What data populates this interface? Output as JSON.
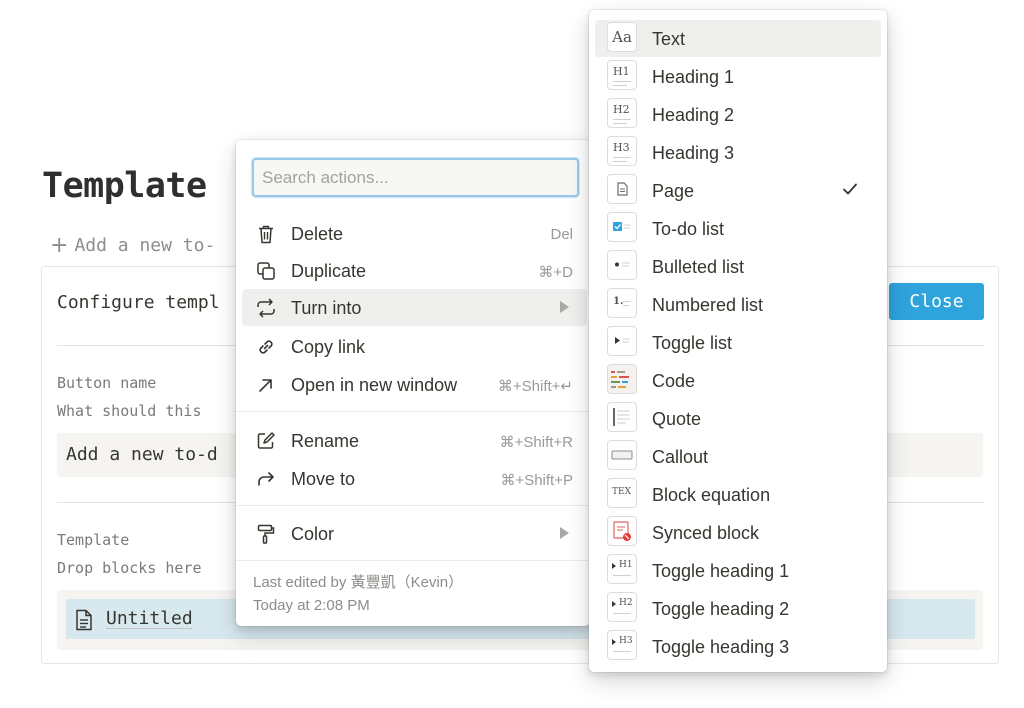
{
  "page": {
    "title": "Template",
    "add_todo": "Add a new to-"
  },
  "config": {
    "title": "Configure templ",
    "close_label": "Close",
    "button_name_label": "Button name",
    "button_name_desc": "What should this",
    "button_name_value": "Add a new to-d",
    "template_label": "Template",
    "template_desc": "Drop blocks here",
    "untitled": "Untitled"
  },
  "menu": {
    "search_placeholder": "Search actions...",
    "items": [
      {
        "label": "Delete",
        "shortcut": "Del",
        "icon": "trash-icon"
      },
      {
        "label": "Duplicate",
        "shortcut": "⌘+D",
        "icon": "duplicate-icon"
      },
      {
        "label": "Turn into",
        "shortcut": "",
        "icon": "turn-into-icon",
        "submenu": true
      },
      {
        "label": "Copy link",
        "shortcut": "",
        "icon": "link-icon"
      },
      {
        "label": "Open in new window",
        "shortcut": "⌘+Shift+↵",
        "icon": "open-window-icon"
      },
      {
        "label": "Rename",
        "shortcut": "⌘+Shift+R",
        "icon": "rename-icon"
      },
      {
        "label": "Move to",
        "shortcut": "⌘+Shift+P",
        "icon": "move-icon"
      },
      {
        "label": "Color",
        "shortcut": "",
        "icon": "paint-roller-icon",
        "submenu": true
      }
    ],
    "edited_by": "Last edited by 黃豐凱（Kevin）",
    "edited_time": "Today at 2:08 PM"
  },
  "turn_into": {
    "items": [
      {
        "label": "Text",
        "icon": "text-icon"
      },
      {
        "label": "Heading 1",
        "icon": "heading-1-icon"
      },
      {
        "label": "Heading 2",
        "icon": "heading-2-icon"
      },
      {
        "label": "Heading 3",
        "icon": "heading-3-icon"
      },
      {
        "label": "Page",
        "icon": "page-icon",
        "checked": true
      },
      {
        "label": "To-do list",
        "icon": "todo-icon"
      },
      {
        "label": "Bulleted list",
        "icon": "bulleted-list-icon"
      },
      {
        "label": "Numbered list",
        "icon": "numbered-list-icon"
      },
      {
        "label": "Toggle list",
        "icon": "toggle-list-icon"
      },
      {
        "label": "Code",
        "icon": "code-icon"
      },
      {
        "label": "Quote",
        "icon": "quote-icon"
      },
      {
        "label": "Callout",
        "icon": "callout-icon"
      },
      {
        "label": "Block equation",
        "icon": "equation-icon"
      },
      {
        "label": "Synced block",
        "icon": "synced-block-icon"
      },
      {
        "label": "Toggle heading 1",
        "icon": "toggle-heading-1-icon"
      },
      {
        "label": "Toggle heading 2",
        "icon": "toggle-heading-2-icon"
      },
      {
        "label": "Toggle heading 3",
        "icon": "toggle-heading-3-icon"
      }
    ],
    "thumb_text": {
      "text": "Aa",
      "h1": "H1",
      "h2": "H2",
      "h3": "H3",
      "numbered": "1.",
      "equation": "TEX"
    }
  },
  "colors": {
    "accent": "#2ea3dc",
    "highlight": "#efefed",
    "text": "#37352f",
    "muted": "#9b9a97",
    "untitled_bg": "#d7e8ef"
  }
}
